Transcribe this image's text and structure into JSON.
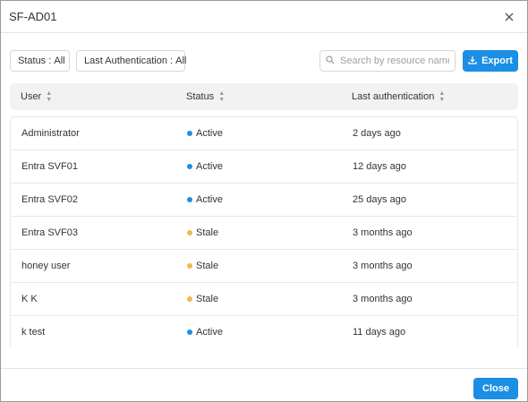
{
  "dialog": {
    "title": "SF-AD01",
    "close_icon": "close-icon"
  },
  "filters": {
    "status": {
      "label": "Status",
      "value": "All"
    },
    "last_auth": {
      "label": "Last Authentication",
      "value": "All"
    }
  },
  "search": {
    "placeholder": "Search by resource name",
    "icon": "search-icon"
  },
  "export": {
    "label": "Export",
    "icon": "download-icon"
  },
  "table": {
    "columns": [
      {
        "label": "User"
      },
      {
        "label": "Status"
      },
      {
        "label": "Last authentication"
      }
    ],
    "rows": [
      {
        "user": "Administrator",
        "status": "Active",
        "last_auth": "2 days ago"
      },
      {
        "user": "Entra SVF01",
        "status": "Active",
        "last_auth": "12 days ago"
      },
      {
        "user": "Entra SVF02",
        "status": "Active",
        "last_auth": "25 days ago"
      },
      {
        "user": "Entra SVF03",
        "status": "Stale",
        "last_auth": "3 months ago"
      },
      {
        "user": "honey user",
        "status": "Stale",
        "last_auth": "3 months ago"
      },
      {
        "user": "K K",
        "status": "Stale",
        "last_auth": "3 months ago"
      },
      {
        "user": "k test",
        "status": "Active",
        "last_auth": "11 days ago"
      }
    ]
  },
  "status_colors": {
    "Active": "#1a8fe3",
    "Stale": "#f0b84a"
  },
  "footer": {
    "close_label": "Close"
  }
}
